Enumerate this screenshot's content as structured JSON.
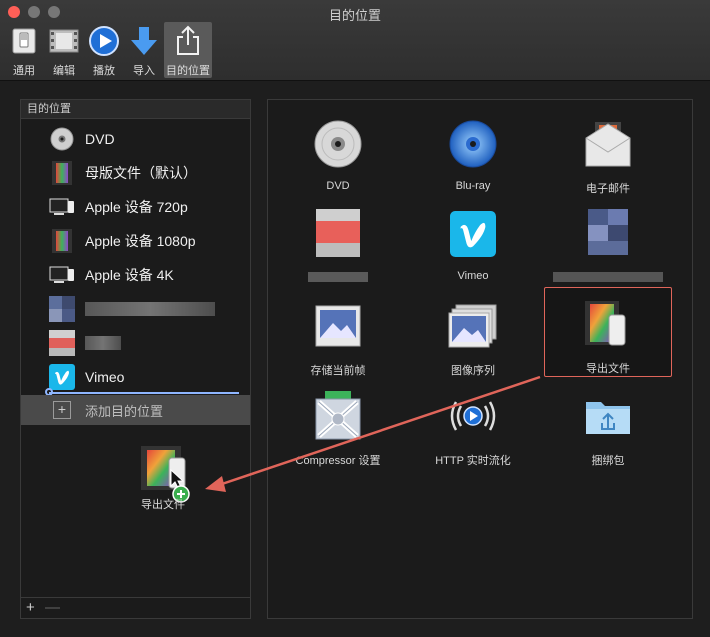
{
  "window": {
    "title": "目的位置"
  },
  "toolbar": {
    "items": [
      {
        "label": "通用"
      },
      {
        "label": "编辑"
      },
      {
        "label": "播放"
      },
      {
        "label": "导入"
      },
      {
        "label": "目的位置"
      }
    ]
  },
  "sidebar": {
    "header": "目的位置",
    "items": [
      {
        "label": "DVD",
        "icon": "dvd-disc-icon"
      },
      {
        "label": "母版文件（默认）",
        "icon": "film-strip-icon"
      },
      {
        "label": "Apple 设备 720p",
        "icon": "apple-device-icon"
      },
      {
        "label": "Apple 设备 1080p",
        "icon": "film-strip-icon"
      },
      {
        "label": "Apple 设备 4K",
        "icon": "apple-device-icon"
      },
      {
        "label": "",
        "icon": "blurred-icon"
      },
      {
        "label": "",
        "icon": "blurred-icon"
      },
      {
        "label": "Vimeo",
        "icon": "vimeo-icon"
      }
    ],
    "add_label": "添加目的位置",
    "drag_label": "导出文件",
    "footer_plus": "+",
    "footer_minus": "—"
  },
  "grid": {
    "tiles": [
      {
        "label": "DVD",
        "icon": "dvd-disc-icon"
      },
      {
        "label": "Blu-ray",
        "icon": "bluray-disc-icon"
      },
      {
        "label": "电子邮件",
        "icon": "email-envelope-icon"
      },
      {
        "label": "",
        "icon": "blurred-icon"
      },
      {
        "label": "Vimeo",
        "icon": "vimeo-icon"
      },
      {
        "label": "",
        "icon": "blurred-icon"
      },
      {
        "label": "存储当前帧",
        "icon": "picture-frame-icon"
      },
      {
        "label": "图像序列",
        "icon": "image-sequence-icon"
      },
      {
        "label": "导出文件",
        "icon": "export-file-icon"
      },
      {
        "label": "Compressor 设置",
        "icon": "compressor-icon"
      },
      {
        "label": "HTTP 实时流化",
        "icon": "http-streaming-icon"
      },
      {
        "label": "捆绑包",
        "icon": "bundle-folder-icon"
      }
    ]
  },
  "colors": {
    "highlight_border": "#e0655a",
    "arrow": "#e0655a",
    "vimeo": "#1ab7ea"
  }
}
